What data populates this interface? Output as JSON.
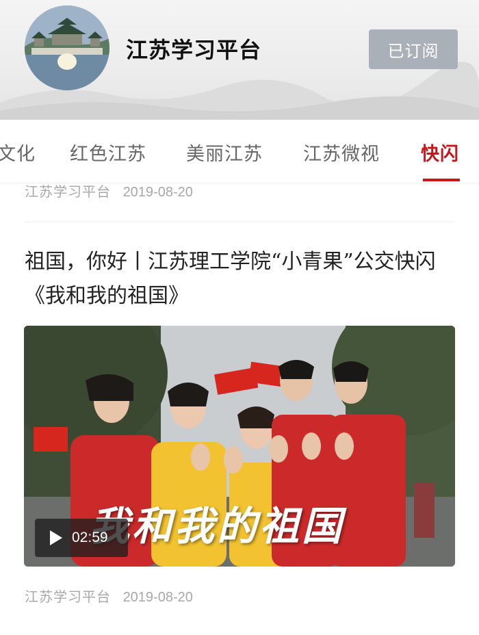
{
  "channel": {
    "title": "江苏学习平台",
    "subscribe_label": "已订阅"
  },
  "tabs": [
    {
      "label": "文化",
      "active": false
    },
    {
      "label": "红色江苏",
      "active": false
    },
    {
      "label": "美丽江苏",
      "active": false
    },
    {
      "label": "江苏微视",
      "active": false
    },
    {
      "label": "快闪",
      "active": true
    }
  ],
  "articles": [
    {
      "source": "江苏学习平台",
      "date": "2019-08-20"
    },
    {
      "title": "祖国，你好丨江苏理工学院“小青果”公交快闪《我和我的祖国》",
      "video_overlay_text": "我和我的祖国",
      "duration": "02:59",
      "source": "江苏学习平台",
      "date": "2019-08-20"
    }
  ],
  "colors": {
    "accent": "#c8161d",
    "subscribe_bg": "#a9b0b8",
    "meta_text": "#a8a8a8"
  },
  "icons": {
    "play": "play-icon",
    "avatar": "pavilion-avatar"
  }
}
